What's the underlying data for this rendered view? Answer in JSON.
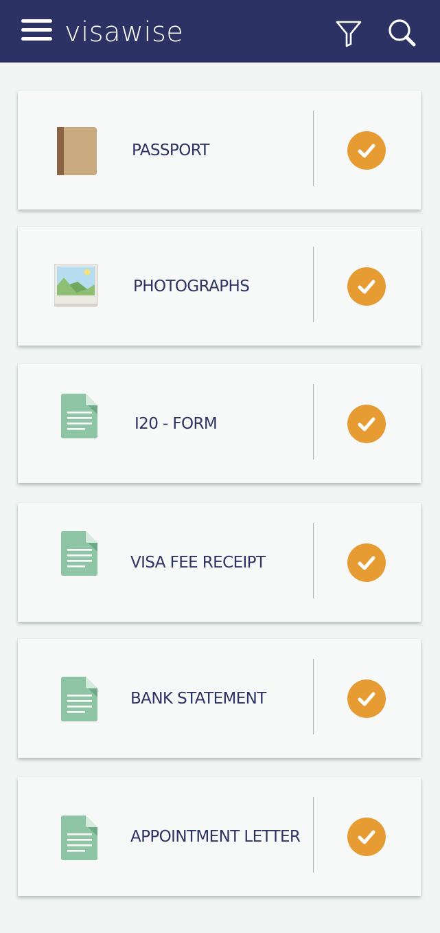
{
  "app": {
    "title": "visawise"
  },
  "colors": {
    "header": "#2c3364",
    "background": "#f1f6f4",
    "card": "#f6f9f8",
    "accent": "#e69c32",
    "text": "#2c3364",
    "doc_icon": "#8dc5a5"
  },
  "header_icons": [
    "hamburger-menu-icon",
    "filter-icon",
    "search-icon"
  ],
  "documents": [
    {
      "label": "PASSPORT",
      "icon": "passport-book-icon",
      "status": "checked"
    },
    {
      "label": "PHOTOGRAPHS",
      "icon": "photo-icon",
      "status": "checked"
    },
    {
      "label": "I20 - FORM",
      "icon": "document-icon",
      "status": "checked"
    },
    {
      "label": "VISA FEE RECEIPT",
      "icon": "document-icon",
      "status": "checked"
    },
    {
      "label": "BANK STATEMENT",
      "icon": "document-icon",
      "status": "checked"
    },
    {
      "label": "APPOINTMENT LETTER",
      "icon": "document-icon",
      "status": "checked"
    }
  ]
}
